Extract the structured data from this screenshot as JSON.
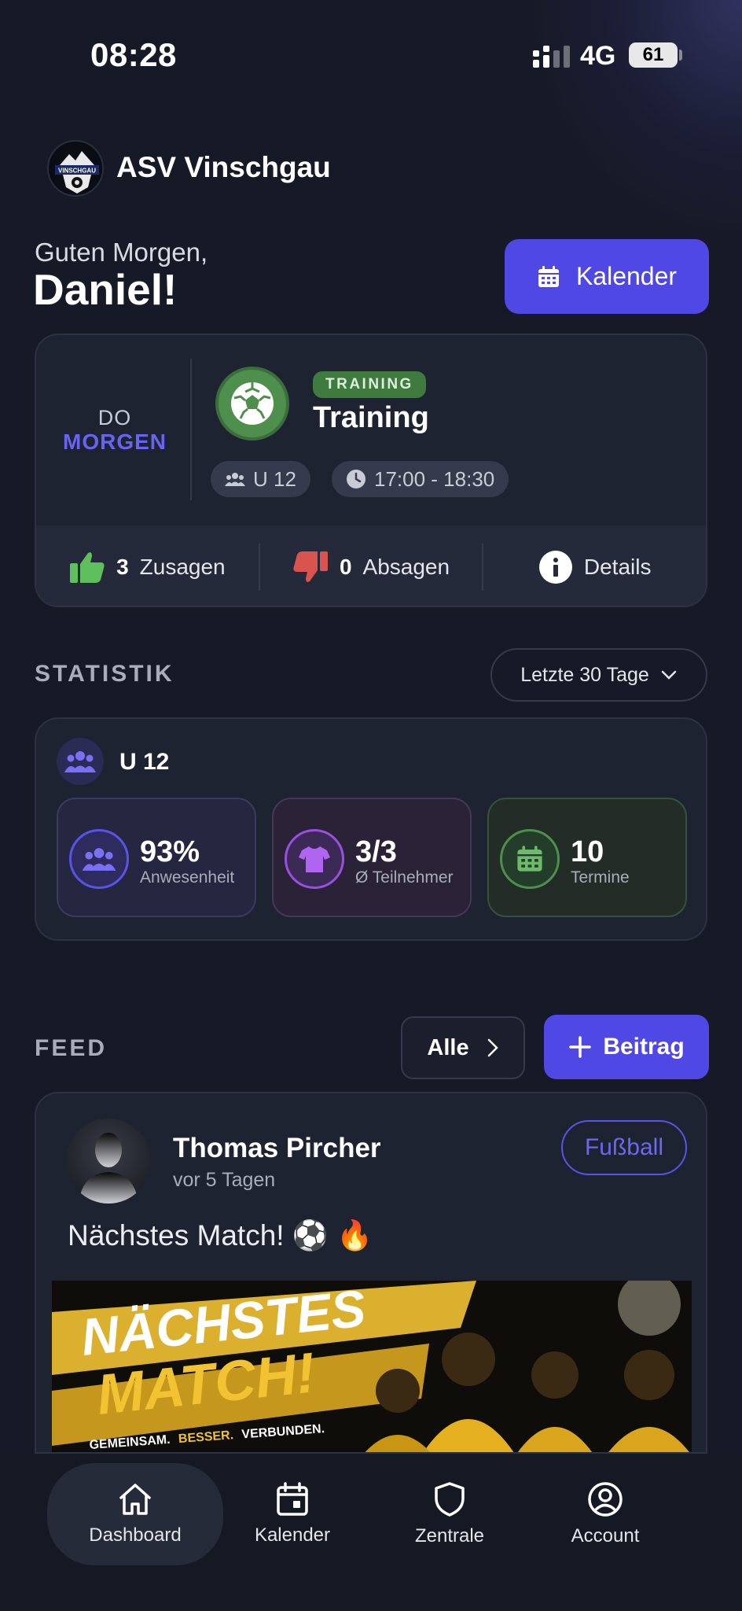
{
  "status_bar": {
    "time": "08:28",
    "network": "4G",
    "battery": "61"
  },
  "club": {
    "name": "ASV Vinschgau",
    "logo_text": "VINSCHGAU"
  },
  "greeting": {
    "line1": "Guten Morgen,",
    "name": "Daniel!"
  },
  "calendar_button": {
    "label": "Kalender"
  },
  "event": {
    "day": "DO",
    "when": "MORGEN",
    "tag": "TRAINING",
    "title": "Training",
    "team": "U 12",
    "time": "17:00 - 18:30",
    "accept_count": "3",
    "accept_label": "Zusagen",
    "decline_count": "0",
    "decline_label": "Absagen",
    "details_label": "Details"
  },
  "statistik": {
    "heading": "STATISTIK",
    "range": "Letzte 30 Tage",
    "team": "U 12",
    "tiles": [
      {
        "value": "93%",
        "label": "Anwesenheit"
      },
      {
        "value": "3/3",
        "label": "Ø Teilnehmer"
      },
      {
        "value": "10",
        "label": "Termine"
      }
    ]
  },
  "feed": {
    "heading": "FEED",
    "all_label": "Alle",
    "new_post_label": "Beitrag",
    "post": {
      "author": "Thomas Pircher",
      "time": "vor 5 Tagen",
      "category": "Fußball",
      "text": "Nächstes Match! ⚽ 🔥",
      "image_title_1": "NÄCHSTES",
      "image_title_2": "MATCH!",
      "image_slogan_1": "GEMEINSAM.",
      "image_slogan_2": "BESSER.",
      "image_slogan_3": "VERBUNDEN."
    }
  },
  "nav": [
    {
      "label": "Dashboard",
      "icon": "home-icon"
    },
    {
      "label": "Kalender",
      "icon": "calendar-icon"
    },
    {
      "label": "Zentrale",
      "icon": "shield-icon"
    },
    {
      "label": "Account",
      "icon": "user-circle-icon"
    }
  ],
  "colors": {
    "accent": "#5048e5",
    "background": "#161a27",
    "card": "#1e2331",
    "success": "#4f8f4e",
    "danger": "#d9534f"
  }
}
